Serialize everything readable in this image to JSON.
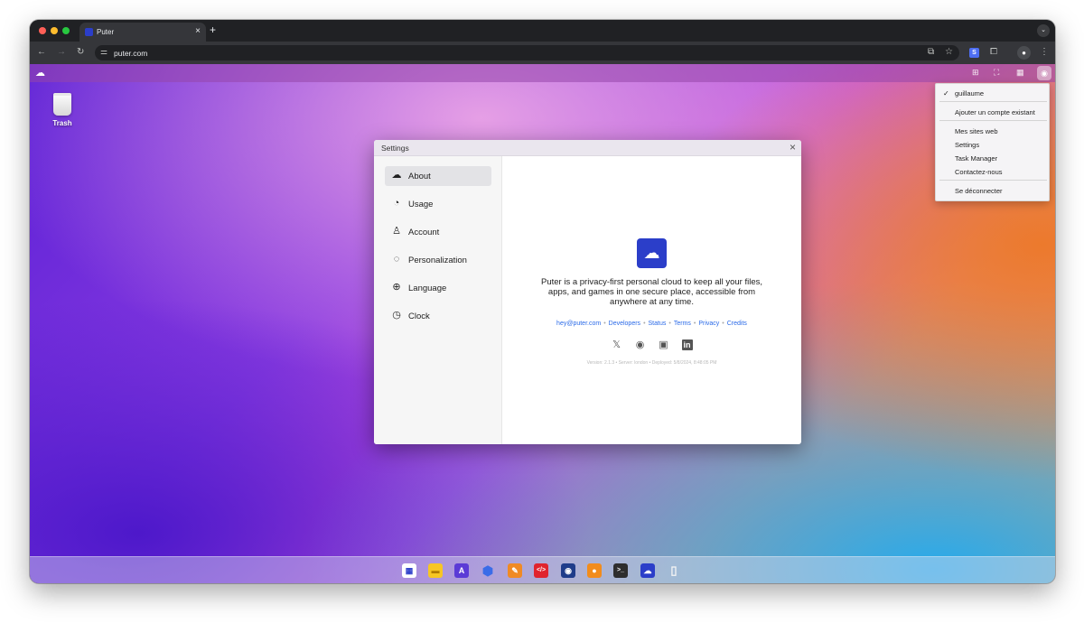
{
  "browser": {
    "tab_title": "Puter",
    "tab_close": "×",
    "new_tab": "+",
    "url": "puter.com",
    "extension_letter": "S"
  },
  "desktop": {
    "trash_label": "Trash"
  },
  "settings": {
    "title": "Settings",
    "close": "×",
    "sidebar": [
      {
        "label": "About",
        "icon": "puter-logo-icon"
      },
      {
        "label": "Usage",
        "icon": "gauge-icon"
      },
      {
        "label": "Account",
        "icon": "user-icon"
      },
      {
        "label": "Personalization",
        "icon": "palette-icon"
      },
      {
        "label": "Language",
        "icon": "globe-icon"
      },
      {
        "label": "Clock",
        "icon": "clock-icon"
      }
    ],
    "active_item": "About",
    "about": {
      "description": "Puter is a privacy-first personal cloud to keep all your files, apps, and games in one secure place, accessible from anywhere at any time.",
      "links": [
        "hey@puter.com",
        "Developers",
        "Status",
        "Terms",
        "Privacy",
        "Credits"
      ],
      "link_separator": "•",
      "social": [
        "x-icon",
        "github-icon",
        "discord-icon",
        "linkedin-icon"
      ],
      "version": "Version: 2.1.3 • Server: london • Deployed: 5/8/2024, 8:48:05 PM"
    }
  },
  "user_menu": {
    "current_user": "guillaume",
    "check": "✓",
    "add_account": "Ajouter un compte existant",
    "items": [
      "Mes sites web",
      "Settings",
      "Task Manager",
      "Contactez-nous"
    ],
    "logout": "Se déconnecter"
  },
  "taskbar": [
    "app-grid-icon",
    "files-icon",
    "editor-icon",
    "dev-center-icon",
    "draw-icon",
    "code-icon",
    "camera-icon",
    "recorder-icon",
    "terminal-icon",
    "puter-icon",
    "trash-icon"
  ],
  "colors": {
    "puter_blue": "#2b3ec9",
    "link_blue": "#2a6ae8"
  }
}
